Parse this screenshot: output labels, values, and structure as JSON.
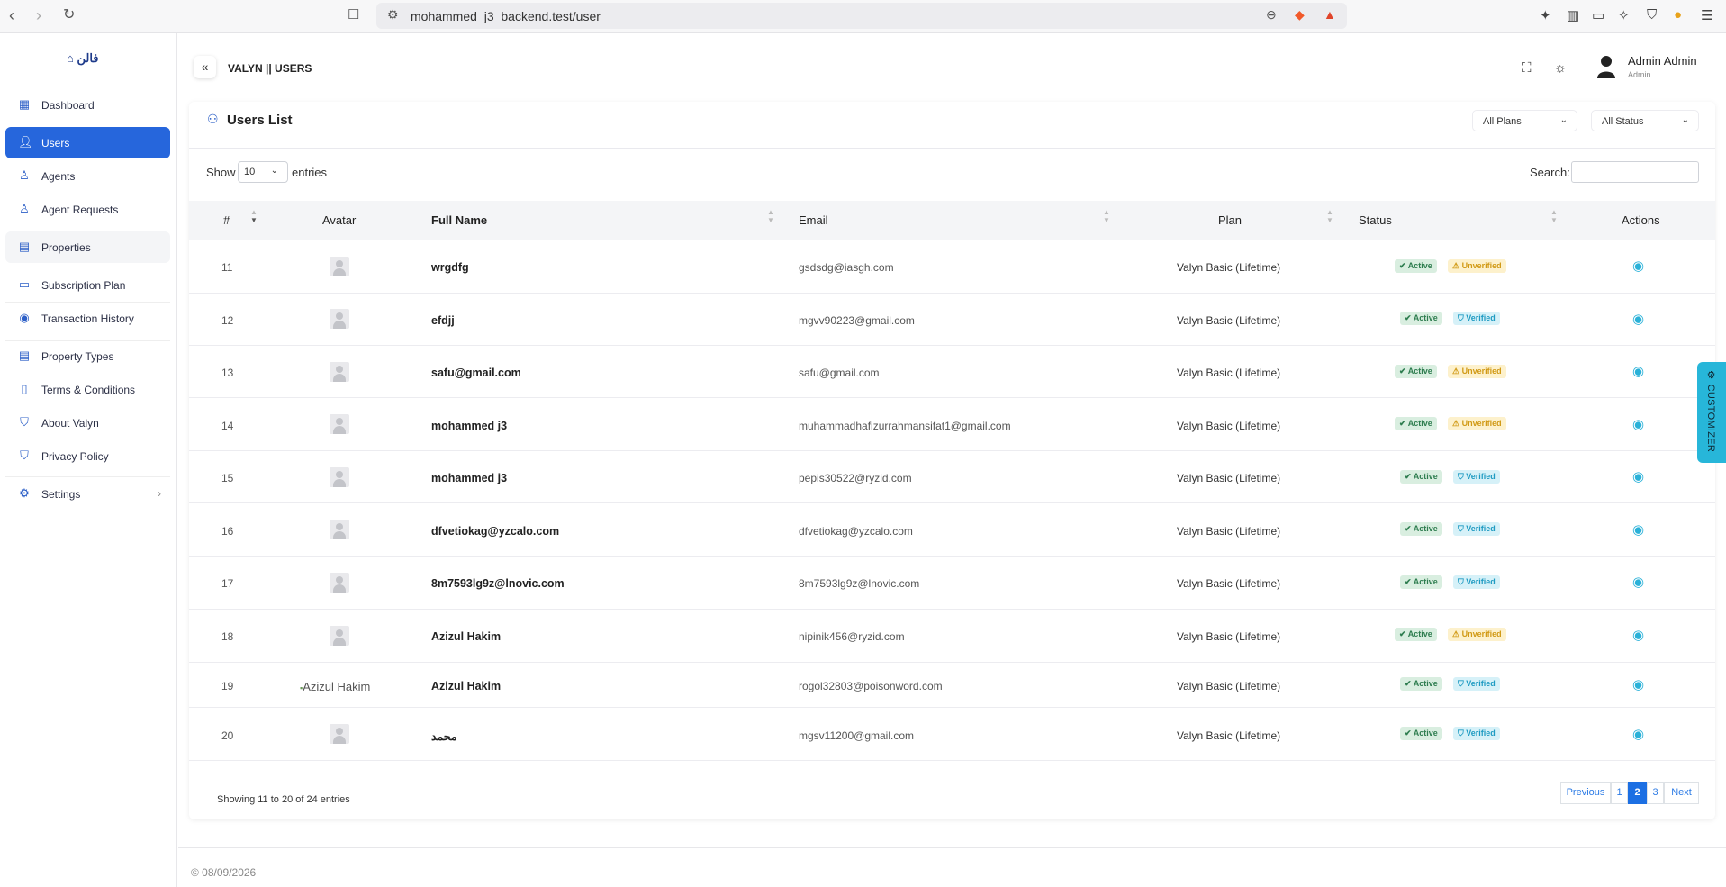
{
  "browser": {
    "url": "mohammed_j3_backend.test/user"
  },
  "sidebar": {
    "logo": "فالن",
    "items": [
      {
        "label": "Dashboard",
        "icon": "dashboard-icon"
      },
      {
        "label": "Users",
        "icon": "user-icon"
      },
      {
        "label": "Agents",
        "icon": "agent-icon"
      },
      {
        "label": "Agent Requests",
        "icon": "agent-requests-icon"
      },
      {
        "label": "Properties",
        "icon": "building-icon"
      },
      {
        "label": "Subscription Plan",
        "icon": "subscription-icon"
      },
      {
        "label": "Transaction History",
        "icon": "history-icon"
      },
      {
        "label": "Property Types",
        "icon": "building-types-icon"
      },
      {
        "label": "Terms & Conditions",
        "icon": "document-icon"
      },
      {
        "label": "About Valyn",
        "icon": "shield-info-icon"
      },
      {
        "label": "Privacy Policy",
        "icon": "shield-icon"
      },
      {
        "label": "Settings",
        "icon": "gear-icon"
      }
    ]
  },
  "header": {
    "title": "VALYN || USERS",
    "user_name": "Admin Admin",
    "user_role": "Admin"
  },
  "card": {
    "title": "Users List",
    "filter_plans": "All Plans",
    "filter_status": "All Status",
    "show": "Show",
    "length": "10",
    "entries": "entries",
    "search": "Search:"
  },
  "table": {
    "headers": [
      "#",
      "Avatar",
      "Full Name",
      "Email",
      "Plan",
      "Status",
      "Actions"
    ],
    "rows": [
      {
        "id": "11",
        "name": "wrgdfg",
        "email": "gsdsdg@iasgh.com",
        "plan": "Valyn Basic (Lifetime)",
        "status": "Active",
        "verify": "Unverified"
      },
      {
        "id": "12",
        "name": "efdjj",
        "email": "mgvv90223@gmail.com",
        "plan": "Valyn Basic (Lifetime)",
        "status": "Active",
        "verify": "Verified"
      },
      {
        "id": "13",
        "name": "safu@gmail.com",
        "email": "safu@gmail.com",
        "plan": "Valyn Basic (Lifetime)",
        "status": "Active",
        "verify": "Unverified"
      },
      {
        "id": "14",
        "name": "mohammed j3",
        "email": "muhammadhafizurrahmansifat1@gmail.com",
        "plan": "Valyn Basic (Lifetime)",
        "status": "Active",
        "verify": "Unverified"
      },
      {
        "id": "15",
        "name": "mohammed j3",
        "email": "pepis30522@ryzid.com",
        "plan": "Valyn Basic (Lifetime)",
        "status": "Active",
        "verify": "Verified"
      },
      {
        "id": "16",
        "name": "dfvetiokag@yzcalo.com",
        "email": "dfvetiokag@yzcalo.com",
        "plan": "Valyn Basic (Lifetime)",
        "status": "Active",
        "verify": "Verified"
      },
      {
        "id": "17",
        "name": "8m7593lg9z@lnovic.com",
        "email": "8m7593lg9z@lnovic.com",
        "plan": "Valyn Basic (Lifetime)",
        "status": "Active",
        "verify": "Verified"
      },
      {
        "id": "18",
        "name": "Azizul Hakim",
        "email": "nipinik456@ryzid.com",
        "plan": "Valyn Basic (Lifetime)",
        "status": "Active",
        "verify": "Unverified"
      },
      {
        "id": "19",
        "name": "Azizul Hakim",
        "email": "rogol32803@poisonword.com",
        "plan": "Valyn Basic (Lifetime)",
        "status": "Active",
        "verify": "Verified",
        "avatar_alt": "Azizul Hakim"
      },
      {
        "id": "20",
        "name": "محمد",
        "email": "mgsv11200@gmail.com",
        "plan": "Valyn Basic (Lifetime)",
        "status": "Active",
        "verify": "Verified"
      }
    ]
  },
  "pagination": {
    "info": "Showing 11 to 20 of 24 entries",
    "previous": "Previous",
    "pages": [
      "1",
      "2",
      "3"
    ],
    "next": "Next"
  },
  "footer": {
    "copyright": "© 08/09/2026"
  },
  "customizer": {
    "label": "CUSTOMIZER"
  },
  "colors": {
    "primary": "#2666dc",
    "active_badge": "#2e7d4f",
    "unverified_badge": "#d19a16",
    "verified_badge": "#1f9bc2",
    "action_icon": "#2ab1d8"
  }
}
